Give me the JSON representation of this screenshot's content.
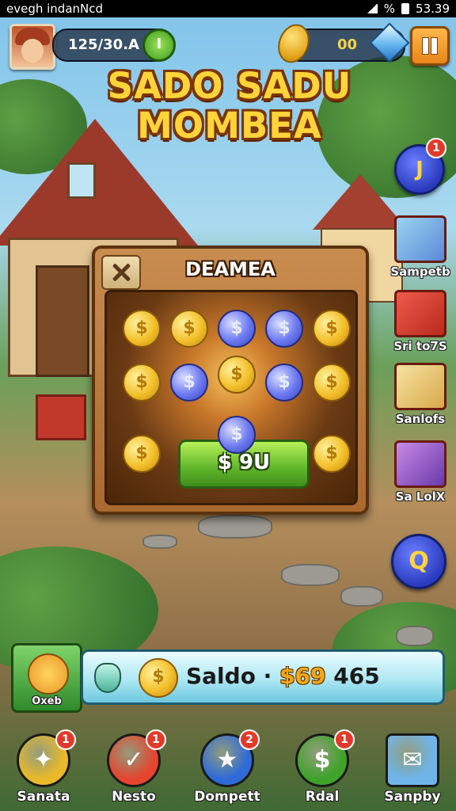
{
  "status_bar": {
    "left_text": "evegh indanNcd",
    "battery": "%",
    "time": "53.39"
  },
  "hud": {
    "score": "125/30.A",
    "score_badge": "I",
    "coins": "00"
  },
  "title": {
    "line1": "SADO SADU",
    "line2": "MOMBEA"
  },
  "side_menu": [
    {
      "label": "Sampetb",
      "icon": "treasure-box-icon"
    },
    {
      "label": "Sri to7S",
      "icon": "gift-crate-icon"
    },
    {
      "label": "Sanlofs",
      "icon": "cash-stack-icon"
    },
    {
      "label": "Sa LolX",
      "icon": "gem-chest-icon"
    }
  ],
  "side_buttons": [
    {
      "glyph": "J",
      "badge": "1"
    },
    {
      "glyph": "Q"
    }
  ],
  "dialog": {
    "title": "DEAMEA",
    "claim_label": "$ 9U",
    "coin_glyph": "$",
    "coins": [
      [
        "gold",
        "gold",
        "blue",
        "blue",
        "gold"
      ],
      [
        "gold",
        "blue",
        "gold",
        "blue",
        "gold"
      ],
      [
        "gold",
        "blue",
        "gold"
      ]
    ]
  },
  "balance": {
    "hero_label": "Oxeb",
    "label": "Saldo · ",
    "amount": "$69",
    "amount_rest": " 465"
  },
  "bottom_nav": [
    {
      "label": "Sanata",
      "badge": "1",
      "icon": "compass-star-icon",
      "color": "#e9b92a"
    },
    {
      "label": "Nesto",
      "badge": "1",
      "icon": "check-badge-icon",
      "color": "#e5452f"
    },
    {
      "label": "Dompett",
      "badge": "2",
      "icon": "star-icon",
      "color": "#2f6bd8"
    },
    {
      "label": "Rdal",
      "badge": "1",
      "icon": "dollar-coin-icon",
      "color": "#3fa32a"
    },
    {
      "label": "Sanpby",
      "badge": "",
      "icon": "envelope-icon",
      "color": "#6fb4e8"
    }
  ],
  "colors": {
    "gold": "#f3c02a",
    "title": "#ffd43a",
    "sky": "#7fc3ea",
    "wood": "#a9692f"
  }
}
